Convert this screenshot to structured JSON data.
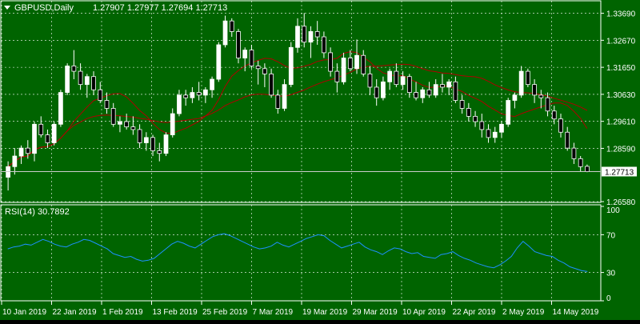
{
  "header": {
    "menu_icon": "triangle-down-icon",
    "symbol_label": "GBPUSD,Daily",
    "ohlc_label": "1.27907 1.27977 1.27694 1.27713"
  },
  "rsi_panel": {
    "label": "RSI(14) 30.7892"
  },
  "price_axis": {
    "ticks": [
      "1.33690",
      "1.32670",
      "1.31650",
      "1.30630",
      "1.29610",
      "1.28590",
      "1.26580"
    ],
    "current_price": "1.27713"
  },
  "rsi_axis": {
    "ticks": [
      "100",
      "70",
      "30",
      "0"
    ]
  },
  "date_axis": {
    "labels": [
      "10 Jan 2019",
      "22 Jan 2019",
      "1 Feb 2019",
      "13 Feb 2019",
      "25 Feb 2019",
      "7 Mar 2019",
      "19 Mar 2019",
      "29 Mar 2019",
      "10 Apr 2019",
      "22 Apr 2019",
      "2 May 2019",
      "14 May 2019"
    ]
  },
  "colors": {
    "background": "#006400",
    "axis": "#ffffff",
    "bull_candle": "#ffffff",
    "bear_candle": "#000000",
    "moving_average": "#b00000",
    "rsi_line": "#1e90ff",
    "grid": "#ffffff"
  },
  "chart_data": [
    {
      "type": "candlestick",
      "title": "GBPUSD,Daily",
      "ylim": [
        1.2658,
        1.341
      ],
      "y_ticks": [
        1.3369,
        1.3267,
        1.3165,
        1.3063,
        1.2961,
        1.2859,
        1.2658
      ],
      "current_price": 1.27713,
      "series": [
        {
          "values": [
            [
              1.275,
              1.281,
              1.27,
              1.279
            ],
            [
              1.279,
              1.286,
              1.276,
              1.283
            ],
            [
              1.283,
              1.287,
              1.28,
              1.286
            ],
            [
              1.286,
              1.289,
              1.282,
              1.284
            ],
            [
              1.284,
              1.296,
              1.281,
              1.295
            ],
            [
              1.295,
              1.298,
              1.29,
              1.291
            ],
            [
              1.291,
              1.293,
              1.286,
              1.288
            ],
            [
              1.288,
              1.296,
              1.287,
              1.295
            ],
            [
              1.295,
              1.308,
              1.294,
              1.307
            ],
            [
              1.307,
              1.318,
              1.306,
              1.317
            ],
            [
              1.317,
              1.323,
              1.312,
              1.315
            ],
            [
              1.315,
              1.318,
              1.308,
              1.31
            ],
            [
              1.31,
              1.314,
              1.305,
              1.313
            ],
            [
              1.313,
              1.315,
              1.306,
              1.308
            ],
            [
              1.308,
              1.311,
              1.303,
              1.304
            ],
            [
              1.304,
              1.307,
              1.299,
              1.301
            ],
            [
              1.301,
              1.303,
              1.294,
              1.295
            ],
            [
              1.295,
              1.298,
              1.292,
              1.296
            ],
            [
              1.296,
              1.299,
              1.293,
              1.294
            ],
            [
              1.294,
              1.298,
              1.291,
              1.293
            ],
            [
              1.293,
              1.295,
              1.286,
              1.288
            ],
            [
              1.288,
              1.292,
              1.285,
              1.29
            ],
            [
              1.29,
              1.291,
              1.283,
              1.285
            ],
            [
              1.285,
              1.288,
              1.281,
              1.284
            ],
            [
              1.284,
              1.292,
              1.283,
              1.291
            ],
            [
              1.291,
              1.301,
              1.29,
              1.299
            ],
            [
              1.299,
              1.308,
              1.298,
              1.306
            ],
            [
              1.306,
              1.308,
              1.302,
              1.305
            ],
            [
              1.305,
              1.309,
              1.303,
              1.307
            ],
            [
              1.307,
              1.311,
              1.304,
              1.306
            ],
            [
              1.306,
              1.309,
              1.303,
              1.308
            ],
            [
              1.308,
              1.313,
              1.305,
              1.312
            ],
            [
              1.312,
              1.326,
              1.311,
              1.325
            ],
            [
              1.325,
              1.336,
              1.324,
              1.334
            ],
            [
              1.334,
              1.335,
              1.328,
              1.33
            ],
            [
              1.33,
              1.331,
              1.318,
              1.32
            ],
            [
              1.32,
              1.324,
              1.315,
              1.323
            ],
            [
              1.323,
              1.325,
              1.316,
              1.317
            ],
            [
              1.317,
              1.319,
              1.31,
              1.316
            ],
            [
              1.316,
              1.318,
              1.309,
              1.314
            ],
            [
              1.314,
              1.316,
              1.305,
              1.306
            ],
            [
              1.306,
              1.308,
              1.299,
              1.301
            ],
            [
              1.301,
              1.312,
              1.3,
              1.31
            ],
            [
              1.31,
              1.326,
              1.309,
              1.324
            ],
            [
              1.324,
              1.335,
              1.322,
              1.332
            ],
            [
              1.332,
              1.337,
              1.324,
              1.326
            ],
            [
              1.326,
              1.332,
              1.32,
              1.33
            ],
            [
              1.33,
              1.334,
              1.325,
              1.328
            ],
            [
              1.328,
              1.33,
              1.32,
              1.322
            ],
            [
              1.322,
              1.324,
              1.313,
              1.315
            ],
            [
              1.315,
              1.318,
              1.307,
              1.311
            ],
            [
              1.311,
              1.322,
              1.31,
              1.32
            ],
            [
              1.32,
              1.323,
              1.315,
              1.316
            ],
            [
              1.316,
              1.327,
              1.314,
              1.321
            ],
            [
              1.321,
              1.323,
              1.313,
              1.314
            ],
            [
              1.314,
              1.317,
              1.306,
              1.309
            ],
            [
              1.309,
              1.312,
              1.302,
              1.305
            ],
            [
              1.305,
              1.313,
              1.304,
              1.311
            ],
            [
              1.311,
              1.316,
              1.308,
              1.315
            ],
            [
              1.315,
              1.318,
              1.309,
              1.31
            ],
            [
              1.31,
              1.315,
              1.308,
              1.313
            ],
            [
              1.313,
              1.314,
              1.305,
              1.307
            ],
            [
              1.307,
              1.311,
              1.304,
              1.305
            ],
            [
              1.305,
              1.309,
              1.303,
              1.308
            ],
            [
              1.308,
              1.311,
              1.305,
              1.306
            ],
            [
              1.306,
              1.312,
              1.305,
              1.31
            ],
            [
              1.31,
              1.314,
              1.307,
              1.309
            ],
            [
              1.309,
              1.312,
              1.306,
              1.311
            ],
            [
              1.311,
              1.313,
              1.303,
              1.304
            ],
            [
              1.304,
              1.306,
              1.299,
              1.301
            ],
            [
              1.301,
              1.303,
              1.296,
              1.298
            ],
            [
              1.298,
              1.3,
              1.294,
              1.296
            ],
            [
              1.296,
              1.299,
              1.29,
              1.293
            ],
            [
              1.293,
              1.295,
              1.288,
              1.29
            ],
            [
              1.29,
              1.294,
              1.288,
              1.292
            ],
            [
              1.292,
              1.296,
              1.29,
              1.295
            ],
            [
              1.295,
              1.305,
              1.294,
              1.304
            ],
            [
              1.304,
              1.307,
              1.301,
              1.306
            ],
            [
              1.306,
              1.317,
              1.305,
              1.315
            ],
            [
              1.315,
              1.316,
              1.309,
              1.31
            ],
            [
              1.31,
              1.312,
              1.303,
              1.306
            ],
            [
              1.306,
              1.308,
              1.301,
              1.305
            ],
            [
              1.305,
              1.307,
              1.298,
              1.3
            ],
            [
              1.3,
              1.302,
              1.295,
              1.297
            ],
            [
              1.297,
              1.299,
              1.29,
              1.292
            ],
            [
              1.292,
              1.294,
              1.285,
              1.286
            ],
            [
              1.286,
              1.288,
              1.28,
              1.282
            ],
            [
              1.282,
              1.283,
              1.277,
              1.279
            ],
            [
              1.2791,
              1.2798,
              1.2769,
              1.2771
            ]
          ]
        }
      ]
    },
    {
      "type": "line",
      "title": "RSI(14) 30.7892",
      "ylim": [
        0,
        100
      ],
      "y_ticks": [
        100,
        70,
        30,
        0
      ],
      "series": [
        {
          "values": [
            55,
            57,
            58,
            60,
            59,
            62,
            65,
            63,
            60,
            58,
            57,
            60,
            62,
            65,
            64,
            61,
            58,
            55,
            50,
            48,
            46,
            47,
            44,
            42,
            43,
            45,
            50,
            55,
            60,
            63,
            61,
            58,
            56,
            60,
            64,
            68,
            70,
            71,
            69,
            66,
            63,
            60,
            57,
            55,
            56,
            58,
            62,
            59,
            57,
            60,
            63,
            66,
            68,
            70,
            69,
            64,
            60,
            56,
            58,
            60,
            62,
            57,
            54,
            52,
            49,
            53,
            56,
            55,
            52,
            50,
            51,
            47,
            46,
            45,
            49,
            50,
            52,
            48,
            45,
            43,
            40,
            38,
            36,
            35,
            38,
            42,
            47,
            56,
            63,
            58,
            52,
            50,
            48,
            47,
            43,
            40,
            36,
            34,
            32,
            31
          ]
        }
      ]
    }
  ]
}
